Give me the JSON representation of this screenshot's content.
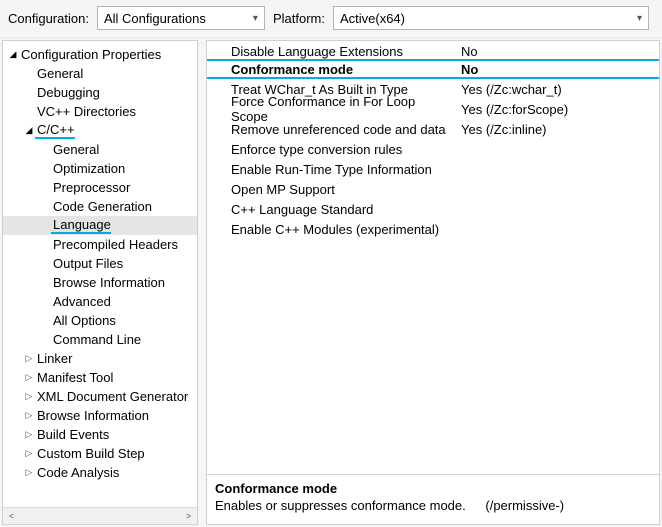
{
  "topbar": {
    "config_label": "Configuration:",
    "config_value": "All Configurations",
    "platform_label": "Platform:",
    "platform_value": "Active(x64)"
  },
  "tree": {
    "root": "Configuration Properties",
    "general": "General",
    "debugging": "Debugging",
    "vcdirs": "VC++ Directories",
    "ccpp": "C/C++",
    "c_general": "General",
    "c_optimization": "Optimization",
    "c_preprocessor": "Preprocessor",
    "c_codegen": "Code Generation",
    "c_language": "Language",
    "c_pch": "Precompiled Headers",
    "c_output": "Output Files",
    "c_browse": "Browse Information",
    "c_advanced": "Advanced",
    "c_all": "All Options",
    "c_cmd": "Command Line",
    "linker": "Linker",
    "manifest": "Manifest Tool",
    "xmldoc": "XML Document Generator",
    "browse": "Browse Information",
    "buildev": "Build Events",
    "cbstep": "Custom Build Step",
    "codean": "Code Analysis"
  },
  "props": [
    {
      "name": "Disable Language Extensions",
      "value": "No"
    },
    {
      "name": "Conformance mode",
      "value": "No"
    },
    {
      "name": "Treat WChar_t As Built in Type",
      "value": "Yes (/Zc:wchar_t)"
    },
    {
      "name": "Force Conformance in For Loop Scope",
      "value": "Yes (/Zc:forScope)"
    },
    {
      "name": "Remove unreferenced code and data",
      "value": "Yes (/Zc:inline)"
    },
    {
      "name": "Enforce type conversion rules",
      "value": ""
    },
    {
      "name": "Enable Run-Time Type Information",
      "value": ""
    },
    {
      "name": "Open MP Support",
      "value": ""
    },
    {
      "name": "C++ Language Standard",
      "value": ""
    },
    {
      "name": "Enable C++ Modules (experimental)",
      "value": ""
    }
  ],
  "desc": {
    "title": "Conformance mode",
    "body": "Enables or suppresses conformance mode.",
    "flag": "(/permissive-)"
  }
}
